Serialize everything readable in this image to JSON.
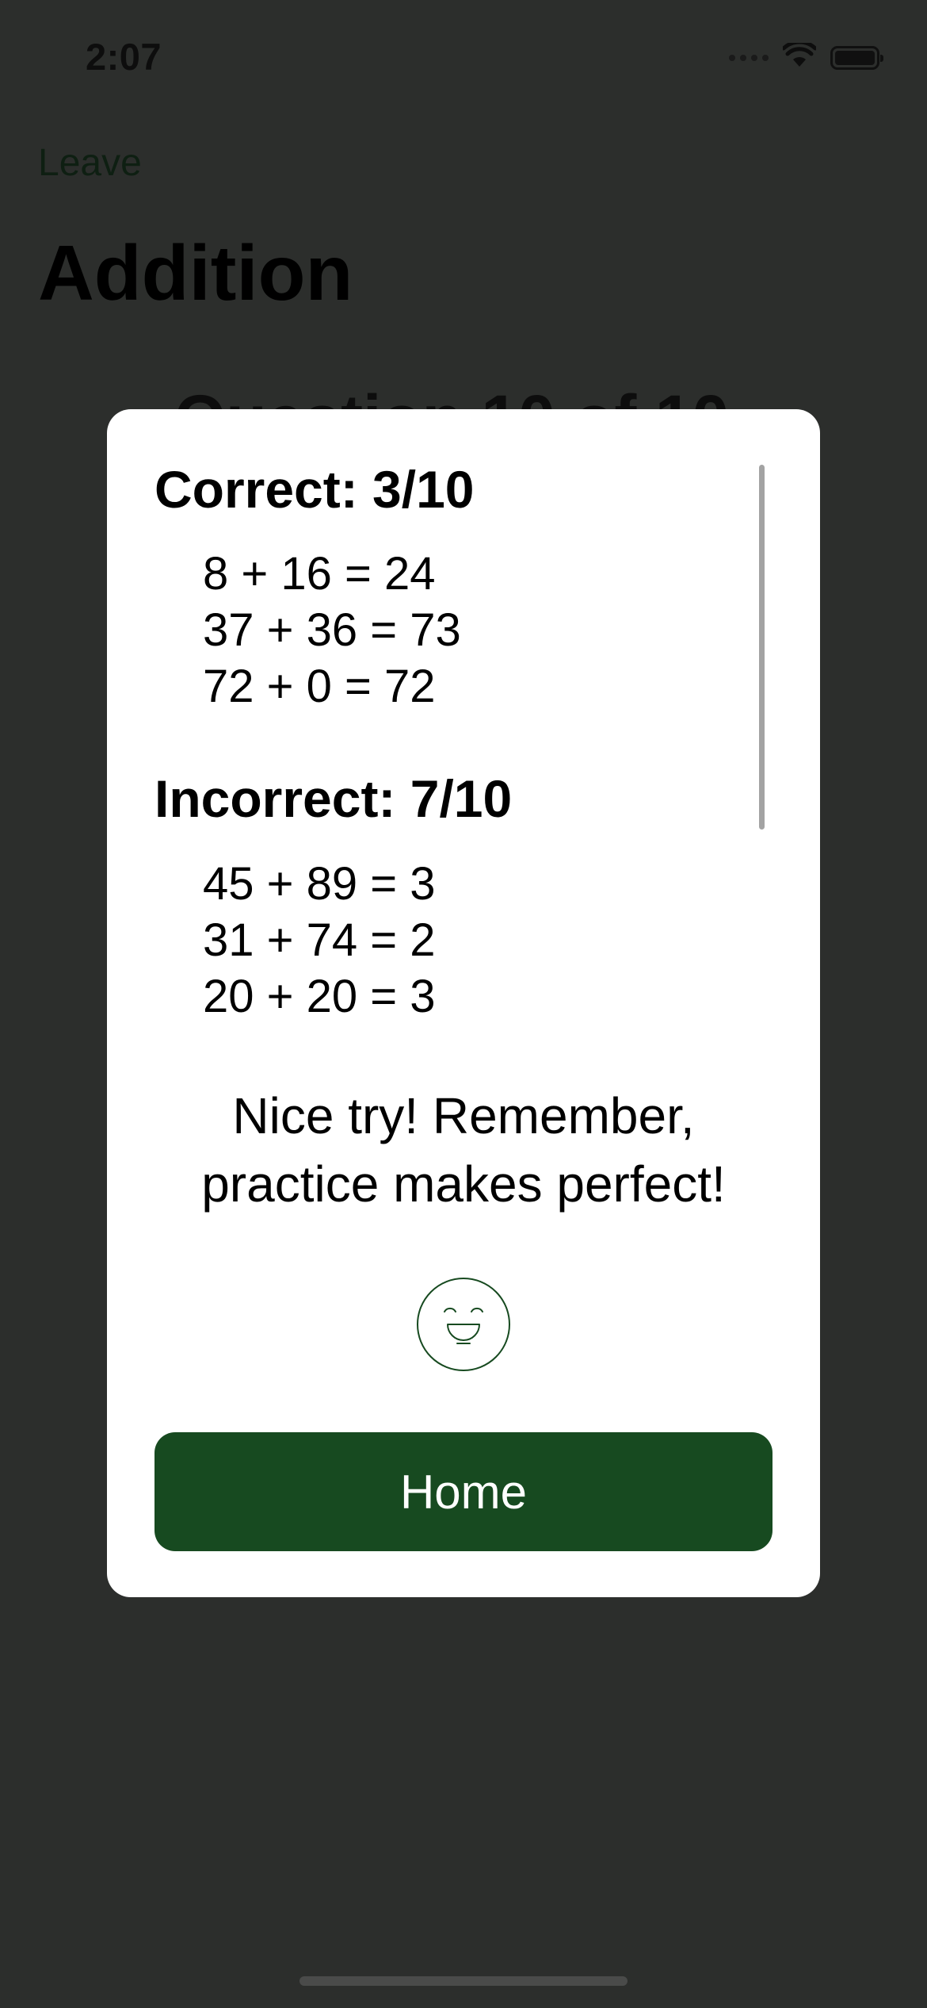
{
  "status_bar": {
    "time": "2:07",
    "icons": [
      "cellular-signal-icon",
      "wifi-icon",
      "battery-icon"
    ]
  },
  "nav": {
    "back_label": "Leave",
    "title": "Addition",
    "question_counter": "Question 10 of 10"
  },
  "modal": {
    "correct_heading": "Correct: 3/10",
    "correct_items": [
      "8 + 16 = 24",
      "37 + 36 = 73",
      "72 + 0 = 72"
    ],
    "incorrect_heading": "Incorrect: 7/10",
    "incorrect_items": [
      "45 + 89 = 3",
      "31 + 74 = 2",
      "20 + 20 = 3"
    ],
    "message_line1": "Nice try! Remember,",
    "message_line2": "practice makes perfect!",
    "face_icon": "smiley-face-icon",
    "home_label": "Home"
  },
  "colors": {
    "accent": "#174a20",
    "overlay_background": "#2c2e2c",
    "modal_background": "#ffffff"
  }
}
